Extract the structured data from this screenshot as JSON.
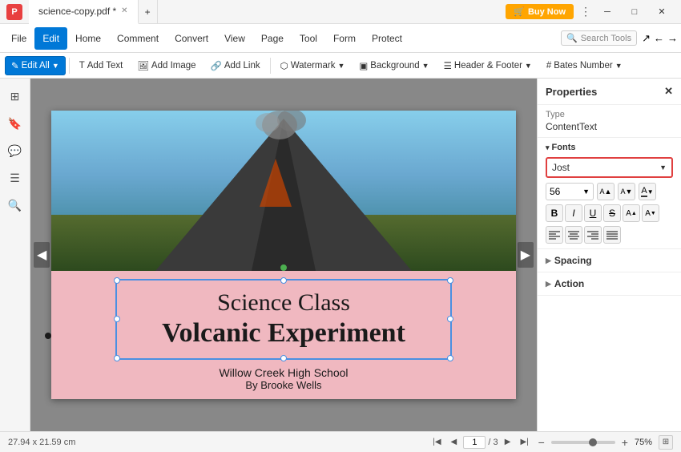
{
  "titlebar": {
    "logo": "P",
    "tabs": [
      {
        "label": "science-copy.pdf *",
        "active": true
      }
    ],
    "buy_now": "Buy Now",
    "minimize": "─",
    "maximize": "□",
    "close": "✕"
  },
  "menubar": {
    "items": [
      {
        "id": "file",
        "label": "File"
      },
      {
        "id": "edit",
        "label": "Edit",
        "active": true
      },
      {
        "id": "home",
        "label": "Home"
      },
      {
        "id": "comment",
        "label": "Comment"
      },
      {
        "id": "convert",
        "label": "Convert"
      },
      {
        "id": "view",
        "label": "View"
      },
      {
        "id": "page",
        "label": "Page"
      },
      {
        "id": "tool",
        "label": "Tool"
      },
      {
        "id": "form",
        "label": "Form"
      },
      {
        "id": "protect",
        "label": "Protect"
      }
    ],
    "search_placeholder": "Search Tools"
  },
  "toolbar": {
    "edit_all": "Edit All",
    "add_text": "Add Text",
    "add_image": "Add Image",
    "add_link": "Add Link",
    "watermark": "Watermark",
    "background": "Background",
    "header_footer": "Header & Footer",
    "bates_number": "Bates Number"
  },
  "props": {
    "title": "Properties",
    "type_label": "Type",
    "type_value": "ContentText",
    "fonts_label": "Fonts",
    "font_name": "Jost",
    "font_size": "56",
    "bold": "B",
    "italic": "I",
    "underline": "U",
    "strikethrough": "S",
    "superscript": "A",
    "subscript": "A",
    "align_left": "≡",
    "align_center": "≡",
    "align_right": "≡",
    "align_justify": "≡",
    "spacing": "Spacing",
    "action": "Action"
  },
  "canvas": {
    "page_info": "1 / 3",
    "doc_size": "27.94 x 21.59 cm",
    "zoom_level": "75%",
    "content": {
      "title1": "Science Class",
      "title2": "Volcanic Experiment",
      "sub1": "Willow Creek High School",
      "sub2": "By Brooke Wells"
    }
  },
  "statusbar": {
    "doc_size": "27.94 x 21.59 cm",
    "page_current": "1",
    "page_sep": "/",
    "page_total": "3"
  }
}
